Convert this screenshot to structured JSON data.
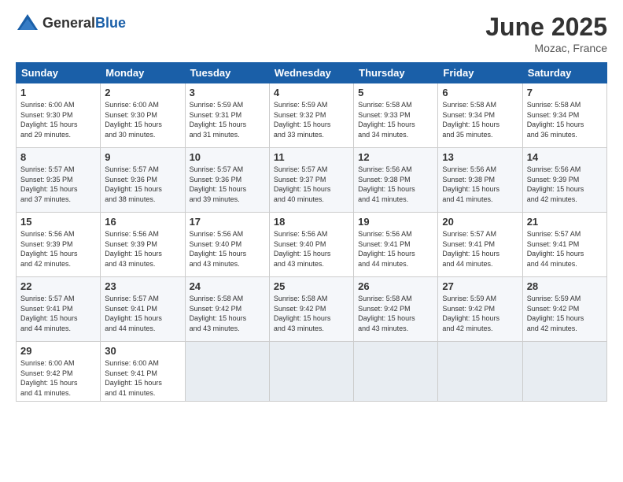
{
  "header": {
    "logo_general": "General",
    "logo_blue": "Blue",
    "month_year": "June 2025",
    "location": "Mozac, France"
  },
  "days_of_week": [
    "Sunday",
    "Monday",
    "Tuesday",
    "Wednesday",
    "Thursday",
    "Friday",
    "Saturday"
  ],
  "weeks": [
    [
      {
        "day": 1,
        "info": "Sunrise: 6:00 AM\nSunset: 9:30 PM\nDaylight: 15 hours\nand 29 minutes."
      },
      {
        "day": 2,
        "info": "Sunrise: 6:00 AM\nSunset: 9:30 PM\nDaylight: 15 hours\nand 30 minutes."
      },
      {
        "day": 3,
        "info": "Sunrise: 5:59 AM\nSunset: 9:31 PM\nDaylight: 15 hours\nand 31 minutes."
      },
      {
        "day": 4,
        "info": "Sunrise: 5:59 AM\nSunset: 9:32 PM\nDaylight: 15 hours\nand 33 minutes."
      },
      {
        "day": 5,
        "info": "Sunrise: 5:58 AM\nSunset: 9:33 PM\nDaylight: 15 hours\nand 34 minutes."
      },
      {
        "day": 6,
        "info": "Sunrise: 5:58 AM\nSunset: 9:34 PM\nDaylight: 15 hours\nand 35 minutes."
      },
      {
        "day": 7,
        "info": "Sunrise: 5:58 AM\nSunset: 9:34 PM\nDaylight: 15 hours\nand 36 minutes."
      }
    ],
    [
      {
        "day": 8,
        "info": "Sunrise: 5:57 AM\nSunset: 9:35 PM\nDaylight: 15 hours\nand 37 minutes."
      },
      {
        "day": 9,
        "info": "Sunrise: 5:57 AM\nSunset: 9:36 PM\nDaylight: 15 hours\nand 38 minutes."
      },
      {
        "day": 10,
        "info": "Sunrise: 5:57 AM\nSunset: 9:36 PM\nDaylight: 15 hours\nand 39 minutes."
      },
      {
        "day": 11,
        "info": "Sunrise: 5:57 AM\nSunset: 9:37 PM\nDaylight: 15 hours\nand 40 minutes."
      },
      {
        "day": 12,
        "info": "Sunrise: 5:56 AM\nSunset: 9:38 PM\nDaylight: 15 hours\nand 41 minutes."
      },
      {
        "day": 13,
        "info": "Sunrise: 5:56 AM\nSunset: 9:38 PM\nDaylight: 15 hours\nand 41 minutes."
      },
      {
        "day": 14,
        "info": "Sunrise: 5:56 AM\nSunset: 9:39 PM\nDaylight: 15 hours\nand 42 minutes."
      }
    ],
    [
      {
        "day": 15,
        "info": "Sunrise: 5:56 AM\nSunset: 9:39 PM\nDaylight: 15 hours\nand 42 minutes."
      },
      {
        "day": 16,
        "info": "Sunrise: 5:56 AM\nSunset: 9:39 PM\nDaylight: 15 hours\nand 43 minutes."
      },
      {
        "day": 17,
        "info": "Sunrise: 5:56 AM\nSunset: 9:40 PM\nDaylight: 15 hours\nand 43 minutes."
      },
      {
        "day": 18,
        "info": "Sunrise: 5:56 AM\nSunset: 9:40 PM\nDaylight: 15 hours\nand 43 minutes."
      },
      {
        "day": 19,
        "info": "Sunrise: 5:56 AM\nSunset: 9:41 PM\nDaylight: 15 hours\nand 44 minutes."
      },
      {
        "day": 20,
        "info": "Sunrise: 5:57 AM\nSunset: 9:41 PM\nDaylight: 15 hours\nand 44 minutes."
      },
      {
        "day": 21,
        "info": "Sunrise: 5:57 AM\nSunset: 9:41 PM\nDaylight: 15 hours\nand 44 minutes."
      }
    ],
    [
      {
        "day": 22,
        "info": "Sunrise: 5:57 AM\nSunset: 9:41 PM\nDaylight: 15 hours\nand 44 minutes."
      },
      {
        "day": 23,
        "info": "Sunrise: 5:57 AM\nSunset: 9:41 PM\nDaylight: 15 hours\nand 44 minutes."
      },
      {
        "day": 24,
        "info": "Sunrise: 5:58 AM\nSunset: 9:42 PM\nDaylight: 15 hours\nand 43 minutes."
      },
      {
        "day": 25,
        "info": "Sunrise: 5:58 AM\nSunset: 9:42 PM\nDaylight: 15 hours\nand 43 minutes."
      },
      {
        "day": 26,
        "info": "Sunrise: 5:58 AM\nSunset: 9:42 PM\nDaylight: 15 hours\nand 43 minutes."
      },
      {
        "day": 27,
        "info": "Sunrise: 5:59 AM\nSunset: 9:42 PM\nDaylight: 15 hours\nand 42 minutes."
      },
      {
        "day": 28,
        "info": "Sunrise: 5:59 AM\nSunset: 9:42 PM\nDaylight: 15 hours\nand 42 minutes."
      }
    ],
    [
      {
        "day": 29,
        "info": "Sunrise: 6:00 AM\nSunset: 9:42 PM\nDaylight: 15 hours\nand 41 minutes."
      },
      {
        "day": 30,
        "info": "Sunrise: 6:00 AM\nSunset: 9:41 PM\nDaylight: 15 hours\nand 41 minutes."
      },
      {
        "day": null,
        "info": ""
      },
      {
        "day": null,
        "info": ""
      },
      {
        "day": null,
        "info": ""
      },
      {
        "day": null,
        "info": ""
      },
      {
        "day": null,
        "info": ""
      }
    ]
  ]
}
